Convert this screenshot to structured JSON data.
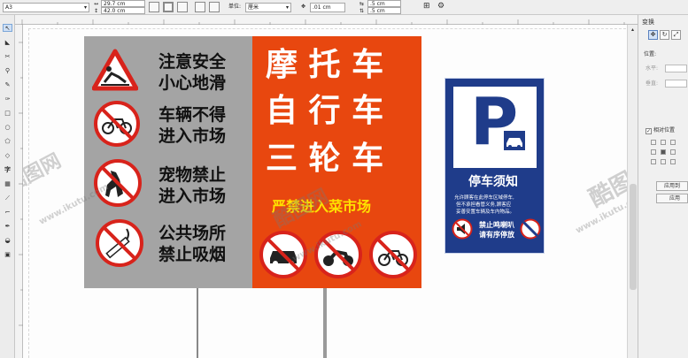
{
  "propbar": {
    "page_size": "A3",
    "width": "29.7 cm",
    "height": "42.0 cm",
    "units_label": "单位:",
    "units_value": "厘米",
    "nudge": ".01 cm",
    "dup_x": ".5 cm",
    "dup_y": ".5 cm"
  },
  "docker": {
    "title": "变换",
    "position_label": "位置:",
    "h_label": "水平:",
    "v_label": "垂直:",
    "relative_label": "相对位置",
    "apply_to_copy": "应用到",
    "apply": "应用"
  },
  "sign_main": {
    "gray_rows": [
      {
        "line1": "注意安全",
        "line2": "小心地滑",
        "icon": "slippery-warning-icon"
      },
      {
        "line1": "车辆不得",
        "line2": "进入市场",
        "icon": "no-bicycle-icon"
      },
      {
        "line1": "宠物禁止",
        "line2": "进入市场",
        "icon": "no-pets-icon"
      },
      {
        "line1": "公共场所",
        "line2": "禁止吸烟",
        "icon": "no-smoking-icon"
      }
    ],
    "orange_lines": [
      "摩 托 车",
      "自 行 车",
      "三 轮 车"
    ],
    "orange_banner": "严禁进入菜市场",
    "orange_icons": [
      "no-car-icon",
      "no-motorcycle-icon",
      "no-bicycle-icon"
    ]
  },
  "sign_parking": {
    "letter": "P",
    "title": "停车须知",
    "notice": [
      "允许顾客在此停车区域停车,",
      "但不承担看管义务,顾客应",
      "妥善安置车辆及车内物品。"
    ],
    "bottom_text": [
      "禁止鸣喇叭",
      "请有序停放"
    ]
  },
  "watermark": {
    "brand": "酷图网",
    "url": "www.ikutu.com"
  },
  "colors": {
    "gray_panel": "#a4a4a4",
    "orange_panel": "#e8470f",
    "banner_yellow": "#ffe100",
    "parking_blue": "#1f3c8a",
    "ban_red": "#d8231b"
  }
}
